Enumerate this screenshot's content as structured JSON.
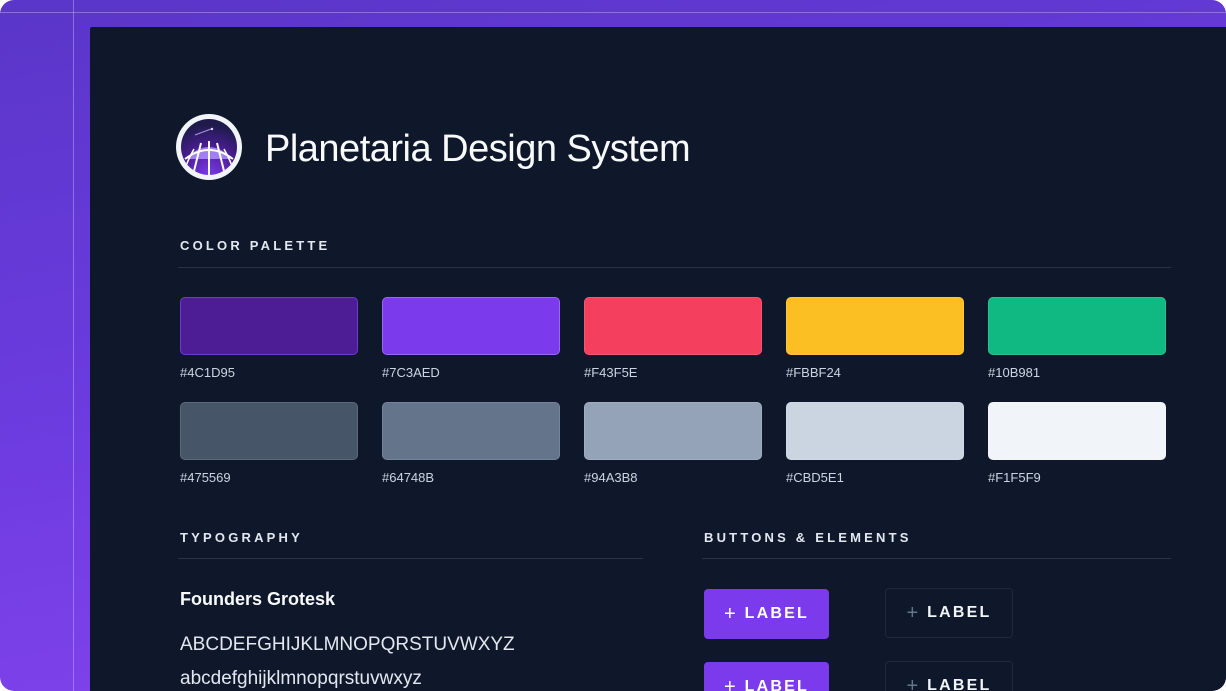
{
  "header": {
    "title": "Planetaria Design System",
    "logo_icon": "planetarium-dome-icon"
  },
  "color_palette": {
    "label": "COLOR PALETTE",
    "rows": [
      [
        {
          "hex": "#4C1D95",
          "label": "#4C1D95"
        },
        {
          "hex": "#7C3AED",
          "label": "#7C3AED"
        },
        {
          "hex": "#F43F5E",
          "label": "#F43F5E"
        },
        {
          "hex": "#FBBF24",
          "label": "#FBBF24"
        },
        {
          "hex": "#10B981",
          "label": "#10B981"
        }
      ],
      [
        {
          "hex": "#475569",
          "label": "#475569"
        },
        {
          "hex": "#64748B",
          "label": "#64748B"
        },
        {
          "hex": "#94A3B8",
          "label": "#94A3B8"
        },
        {
          "hex": "#CBD5E1",
          "label": "#CBD5E1"
        },
        {
          "hex": "#F1F5F9",
          "label": "#F1F5F9"
        }
      ]
    ]
  },
  "typography": {
    "label": "TYPOGRAPHY",
    "font_name": "Founders Grotesk",
    "uppercase": "ABCDEFGHIJKLMNOPQRSTUVWXYZ",
    "lowercase": "abcdefghijklmnopqrstuvwxyz"
  },
  "buttons": {
    "label": "BUTTONS & ELEMENTS",
    "plus_icon": "+",
    "items": [
      {
        "label": "LABEL",
        "style": "primary"
      },
      {
        "label": "LABEL",
        "style": "outline"
      },
      {
        "label": "LABEL",
        "style": "primary"
      },
      {
        "label": "LABEL",
        "style": "outline"
      }
    ]
  },
  "colors": {
    "background": "#0F172A",
    "accent": "#7C3AED",
    "frame": "#6B3BDE"
  }
}
